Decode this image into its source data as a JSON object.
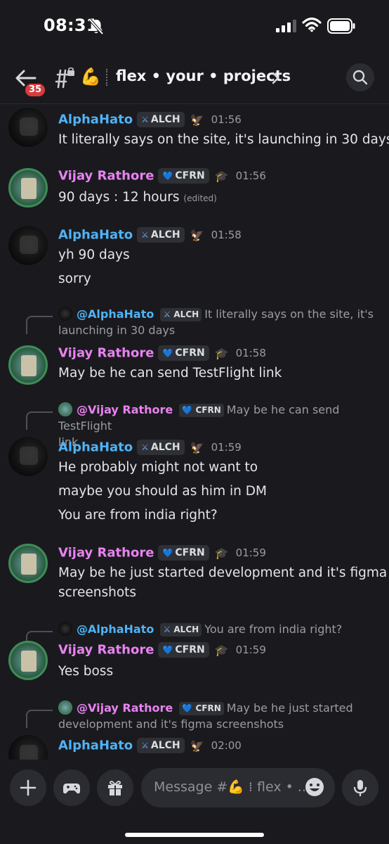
{
  "status_bar": {
    "time": "08:31"
  },
  "header": {
    "back_badge": "35",
    "channel_emoji": "💪",
    "channel_name": "flex • your • projects"
  },
  "messages": [
    {
      "author": "AlphaHato",
      "author_color": "#4fb3f6",
      "tag": "ALCH",
      "time": "01:56",
      "lines": [
        "It literally says on the site,  it's launching in 30 days"
      ]
    },
    {
      "author": "Vijay Rathore",
      "author_color": "#e882f0",
      "tag": "CFRN",
      "time": "01:56",
      "lines": [
        "90 days : 12 hours"
      ],
      "edited": "(edited)"
    },
    {
      "author": "AlphaHato",
      "author_color": "#4fb3f6",
      "tag": "ALCH",
      "time": "01:58",
      "lines": [
        "yh 90 days",
        "sorry"
      ]
    },
    {
      "reply": {
        "author": "@AlphaHato",
        "tag": "ALCH",
        "text_line1": "It literally says on the site,  it's",
        "text_line2": "launching in 30 days"
      },
      "author": "Vijay Rathore",
      "author_color": "#e882f0",
      "tag": "CFRN",
      "time": "01:58",
      "lines": [
        "May be he can send TestFlight link"
      ]
    },
    {
      "reply": {
        "author": "@Vijay Rathore",
        "tag": "CFRN",
        "text_line1": "May be he can send TestFlight",
        "text_line2": "link"
      },
      "author": "AlphaHato",
      "author_color": "#4fb3f6",
      "tag": "ALCH",
      "time": "01:59",
      "lines": [
        "He probably might not want to",
        "maybe you should as him in DM",
        "You are from india right?"
      ]
    },
    {
      "author": "Vijay Rathore",
      "author_color": "#e882f0",
      "tag": "CFRN",
      "time": "01:59",
      "lines": [
        "May be he just started development and it's figma",
        "screenshots"
      ]
    },
    {
      "reply": {
        "author": "@AlphaHato",
        "tag": "ALCH",
        "text_line1": "You are from india right?",
        "text_line2": ""
      },
      "author": "Vijay Rathore",
      "author_color": "#e882f0",
      "tag": "CFRN",
      "time": "01:59",
      "lines": [
        "Yes boss"
      ]
    },
    {
      "reply": {
        "author": "@Vijay Rathore",
        "tag": "CFRN",
        "text_line1": "May be he just started",
        "text_line2": "development and it's figma screenshots"
      },
      "author": "AlphaHato",
      "author_color": "#4fb3f6",
      "tag": "ALCH",
      "time": "02:00",
      "lines": []
    }
  ],
  "composer": {
    "placeholder": "Message #💪 ⁞ flex • ..."
  }
}
